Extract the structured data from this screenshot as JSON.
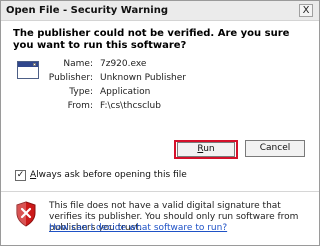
{
  "window": {
    "title": "Open File - Security Warning",
    "close_glyph": "X"
  },
  "headline": "The publisher could not be verified.  Are you sure you want to run this software?",
  "details": [
    {
      "label": "Name:",
      "value": "7z920.exe"
    },
    {
      "label": "Publisher:",
      "value": "Unknown Publisher"
    },
    {
      "label": "Type:",
      "value": "Application"
    },
    {
      "label": "From:",
      "value": "F:\\cs\\thcsclub"
    }
  ],
  "buttons": {
    "run_mnemonic": "R",
    "run_rest": "un",
    "cancel": "Cancel"
  },
  "checkbox": {
    "checked": true,
    "glyph": "✓",
    "label_mnemonic": "A",
    "label_rest": "lways ask before opening this file"
  },
  "warning": {
    "text": "This file does not have a valid digital signature that verifies its publisher.  You should only run software from publishers you trust.",
    "link": "How can I decide what software to run?"
  },
  "colors": {
    "highlight_outline": "#d4102a",
    "link": "#1f52c6",
    "shield_red": "#cc1a1a"
  }
}
